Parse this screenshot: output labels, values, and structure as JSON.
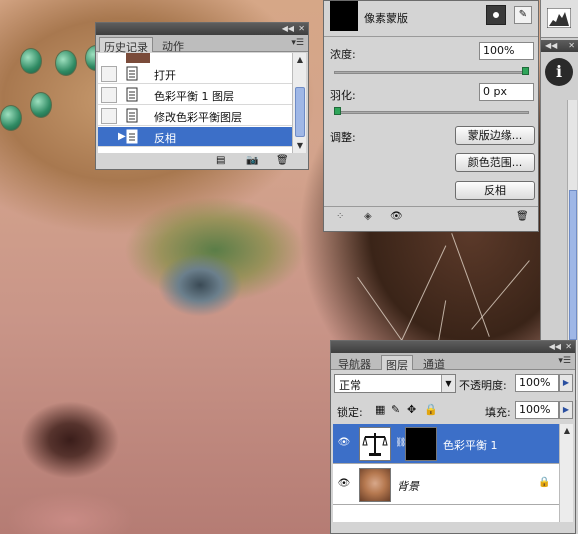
{
  "history": {
    "tabs": [
      "历史记录",
      "动作"
    ],
    "items": [
      {
        "label": "打开"
      },
      {
        "label": "色彩平衡 1 图层"
      },
      {
        "label": "修改色彩平衡图层"
      },
      {
        "label": "反相"
      }
    ],
    "selected_index": 3
  },
  "masks": {
    "title": "像素蒙版",
    "density_label": "浓度:",
    "density_value": "100%",
    "density_level": 1.0,
    "feather_label": "羽化:",
    "feather_value": "0 px",
    "feather_level": 0.0,
    "adjust_label": "调整:",
    "buttons": [
      "蒙版边缘...",
      "颜色范围...",
      "反相"
    ]
  },
  "layers": {
    "tabs": [
      "导航器",
      "图层",
      "通道"
    ],
    "blend_mode": "正常",
    "opacity_label": "不透明度:",
    "opacity_value": "100%",
    "lock_label": "锁定:",
    "fill_label": "填充:",
    "fill_value": "100%",
    "rows": [
      {
        "name": "色彩平衡 1",
        "selected": true
      },
      {
        "name": "背景",
        "selected": false
      }
    ]
  },
  "colors": {
    "selection": "#3c6fc8",
    "panel": "#d4d4d4",
    "titlebar": "#4a4a4a"
  }
}
